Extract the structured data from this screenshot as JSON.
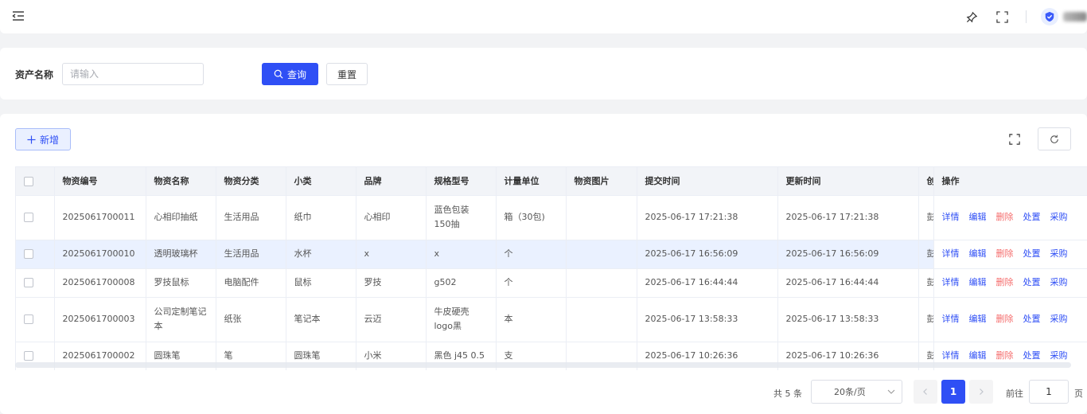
{
  "search": {
    "label": "资产名称",
    "placeholder": "请输入",
    "query_label": "查询",
    "reset_label": "重置"
  },
  "toolbar": {
    "add_label": "新增"
  },
  "table": {
    "columns": [
      "物资编号",
      "物资名称",
      "物资分类",
      "小类",
      "品牌",
      "规格型号",
      "计量单位",
      "物资图片",
      "提交时间",
      "更新时间",
      "创",
      "操作"
    ],
    "actions": [
      "详情",
      "编辑",
      "删除",
      "处置",
      "采购"
    ],
    "rows": [
      {
        "code": "2025061700011",
        "name": "心相印抽纸",
        "category": "生活用品",
        "sub": "纸巾",
        "brand": "心相印",
        "spec": "蓝色包装 150抽",
        "unit": "箱（30包)",
        "img": "",
        "submit": "2025-06-17 17:21:38",
        "update": "2025-06-17 17:21:38",
        "creator": "彭"
      },
      {
        "code": "2025061700010",
        "name": "透明玻璃杯",
        "category": "生活用品",
        "sub": "水杯",
        "brand": "x",
        "spec": "x",
        "unit": "个",
        "img": "",
        "submit": "2025-06-17 16:56:09",
        "update": "2025-06-17 16:56:09",
        "creator": "彭"
      },
      {
        "code": "2025061700008",
        "name": "罗技鼠标",
        "category": "电脑配件",
        "sub": "鼠标",
        "brand": "罗技",
        "spec": "g502",
        "unit": "个",
        "img": "",
        "submit": "2025-06-17 16:44:44",
        "update": "2025-06-17 16:44:44",
        "creator": "彭"
      },
      {
        "code": "2025061700003",
        "name": "公司定制笔记本",
        "category": "纸张",
        "sub": "笔记本",
        "brand": "云迈",
        "spec": "牛皮硬壳logo黑",
        "unit": "本",
        "img": "",
        "submit": "2025-06-17 13:58:33",
        "update": "2025-06-17 13:58:33",
        "creator": "彭"
      },
      {
        "code": "2025061700002",
        "name": "圆珠笔",
        "category": "笔",
        "sub": "圆珠笔",
        "brand": "小米",
        "spec": "黑色 j45 0.5",
        "unit": "支",
        "img": "",
        "submit": "2025-06-17 10:26:36",
        "update": "2025-06-17 10:26:36",
        "creator": "彭"
      }
    ]
  },
  "pagination": {
    "total": "共 5 条",
    "page_size": "20条/页",
    "current_page": "1",
    "goto_label": "前往",
    "goto_value": "1",
    "page_suffix": "页"
  },
  "colors": {
    "primary": "#2f4ff5",
    "danger": "#f56c6c"
  }
}
